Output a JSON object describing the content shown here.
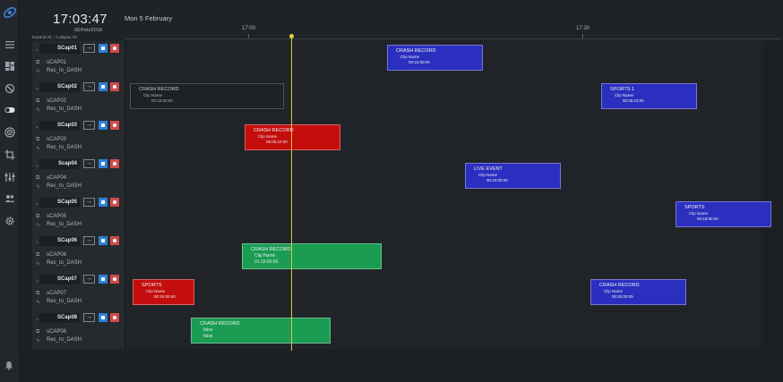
{
  "header": {
    "clock": "17:03:47",
    "date": "05/Feb/2018",
    "expand_all": "Expand All",
    "collapse_all": "Collapse All",
    "day_label": "Mon 5 February",
    "ticks": [
      "17:00",
      "17:30"
    ]
  },
  "sidebar": {
    "icons": [
      "menu-icon",
      "dashboard-icon",
      "timer-icon",
      "toggle-icon",
      "target-icon",
      "crop-icon",
      "sliders-icon",
      "users-icon",
      "gear-icon",
      "bell-icon"
    ]
  },
  "rows": [
    {
      "name": "SCap01",
      "source": "sCAP01",
      "output": "Rec_to_DASH"
    },
    {
      "name": "SCap02",
      "source": "sCAP02",
      "output": "Rec_to_DASH"
    },
    {
      "name": "SCap03",
      "source": "sCAP03",
      "output": "Rec_to_DASH"
    },
    {
      "name": "Scap04",
      "source": "sCAP04",
      "output": "Rec_to_DASH"
    },
    {
      "name": "SCap05",
      "source": "sCAP05",
      "output": "Rec_to_DASH"
    },
    {
      "name": "SCap06",
      "source": "sCAP06",
      "output": "Rec_to_DASH"
    },
    {
      "name": "SCap07",
      "source": "sCAP07",
      "output": "Rec_to_DASH"
    },
    {
      "name": "SCap08",
      "source": "sCAP08",
      "output": "Rec_to_DASH"
    }
  ],
  "events": [
    {
      "title": "CRASH RECORD",
      "clip": "Clip Name",
      "duration": "00:15:00:00",
      "color": "#2b2fbf"
    },
    {
      "title": "CRASH RECORD",
      "clip": "Clip Name",
      "duration": "00:15:00:00",
      "color": "#1e2226"
    },
    {
      "title": "SPORTS 1",
      "clip": "Clip Name",
      "duration": "00:35:10:00",
      "color": "#2b2fbf"
    },
    {
      "title": "CRASH RECORD",
      "clip": "Clip Name",
      "duration": "00:05:10:00",
      "color": "#c40d0d"
    },
    {
      "title": "LIVE EVENT",
      "clip": "Clip Name",
      "duration": "00:15:00:00",
      "color": "#2b2fbf"
    },
    {
      "title": "SPORTS",
      "clip": "Clip Name",
      "duration": "00:15:00:00",
      "color": "#2b2fbf"
    },
    {
      "title": "CRASH RECORD",
      "clip": "Clip Name",
      "duration": "01:15:00:00",
      "color": "#1a9c52"
    },
    {
      "title": "SPORTS",
      "clip": "Clip Name",
      "duration": "00:15:00:00",
      "color": "#c40d0d"
    },
    {
      "title": "CRASH RECORD",
      "clip": "Clip Name",
      "duration": "00:25:00:05",
      "color": "#2b2fbf"
    },
    {
      "title": "CRASH RECORD",
      "clip": "false",
      "duration": "false",
      "color": "#1a9c52"
    }
  ]
}
